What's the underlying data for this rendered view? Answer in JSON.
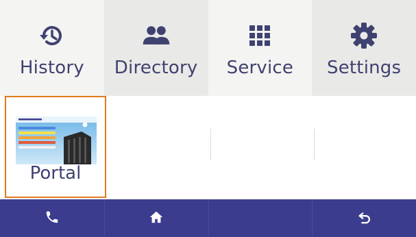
{
  "topbar": {
    "tabs": [
      {
        "label": "History",
        "icon": "history-icon"
      },
      {
        "label": "Directory",
        "icon": "people-icon"
      },
      {
        "label": "Service",
        "icon": "grid-icon"
      },
      {
        "label": "Settings",
        "icon": "gear-icon"
      }
    ]
  },
  "tiles": [
    {
      "label": "Portal",
      "selected": true
    }
  ],
  "bottombar": {
    "buttons": [
      {
        "icon": "phone-icon"
      },
      {
        "icon": "home-icon"
      },
      {
        "icon": "empty"
      },
      {
        "icon": "back-icon"
      }
    ]
  },
  "colors": {
    "accent_text": "#3f4270",
    "bottom_bar": "#3c3c8e",
    "selection_border": "#e07a1c"
  }
}
